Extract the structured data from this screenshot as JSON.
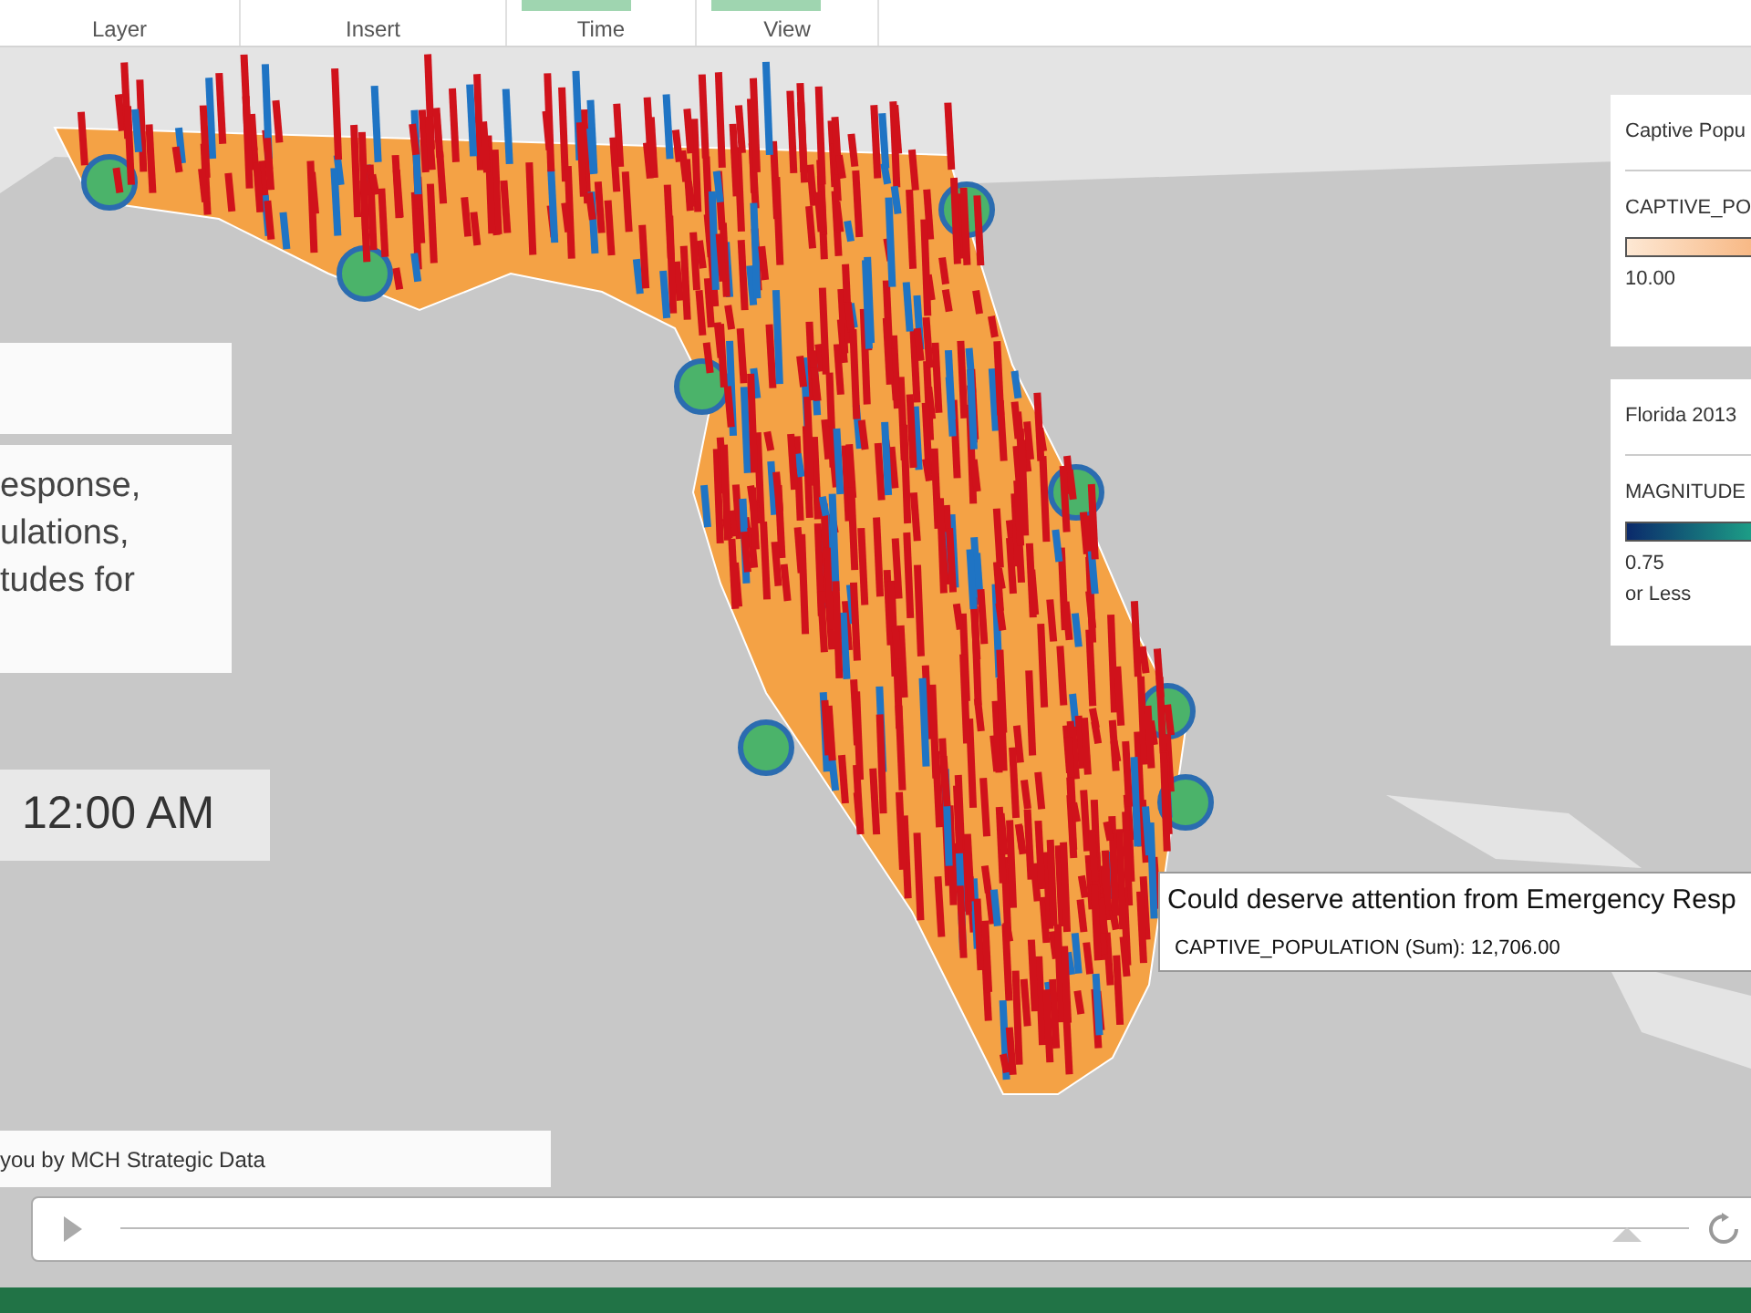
{
  "ribbon": {
    "groups": [
      {
        "label": "Layer",
        "highlighted": false
      },
      {
        "label": "Insert",
        "highlighted": false
      },
      {
        "label": "Time",
        "highlighted": true
      },
      {
        "label": "View",
        "highlighted": true
      }
    ]
  },
  "scene": {
    "description_lines": [
      "esponse,",
      "ulations,",
      "tudes for"
    ],
    "time": "12:00 AM",
    "credit": "you by MCH Strategic Data"
  },
  "legends": [
    {
      "title": "Captive Popu",
      "field": "CAPTIVE_PO",
      "kind": "peach",
      "min_label": "10.00"
    },
    {
      "title": "Florida 2013",
      "field": "MAGNITUDE",
      "kind": "teal",
      "min_label": "0.75",
      "min_sub": "or Less"
    }
  ],
  "tooltip": {
    "title": "Could deserve attention from Emergency Resp",
    "detail": "CAPTIVE_POPULATION (Sum): 12,706.00"
  },
  "timeline": {
    "level": 0.96
  }
}
